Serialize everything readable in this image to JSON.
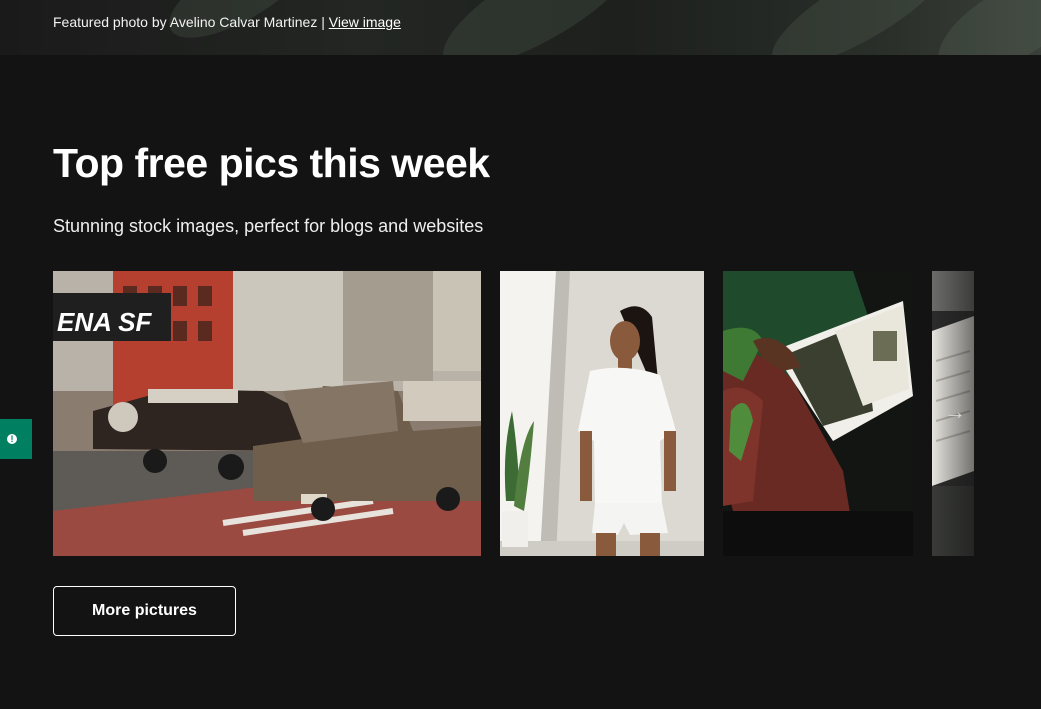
{
  "hero": {
    "credit_prefix": "Featured photo by Avelino Calvar Martinez | ",
    "credit_link": "View image"
  },
  "section": {
    "title": "Top free pics this week",
    "subtitle": "Stunning stock images, perfect for blogs and websites"
  },
  "photos": [
    {
      "subject": "lowrider cars parked on a city street",
      "sign_text": "ENA SF"
    },
    {
      "subject": "woman in white t-shirt and shorts by a window"
    },
    {
      "subject": "person reading a book on a red armchair"
    },
    {
      "subject": "partially visible open book"
    }
  ],
  "carousel": {
    "next_icon": "arrow-right-icon",
    "next_glyph": "→"
  },
  "buttons": {
    "more_label": "More pictures"
  },
  "feedback": {
    "icon": "alert-circle-icon",
    "glyph": "!",
    "color": "#008060"
  },
  "colors": {
    "background": "#131313",
    "accent": "#008060"
  }
}
